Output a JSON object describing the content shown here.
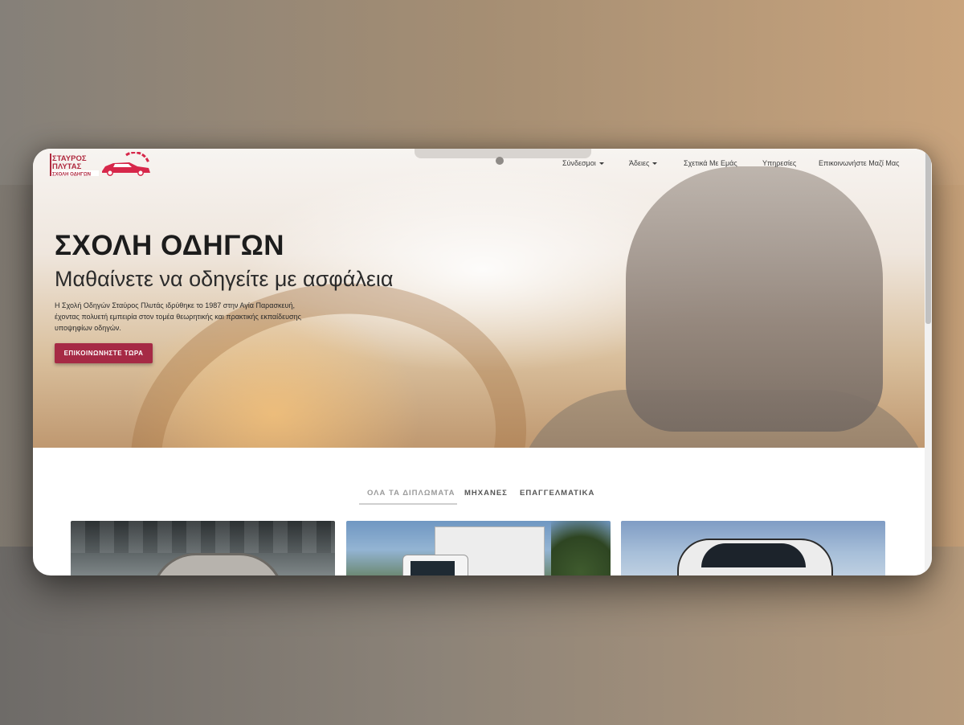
{
  "brand": {
    "logo_line1": "ΣΤΑΥΡΟΣ",
    "logo_line2": "ΠΛΥΤΑΣ",
    "logo_line3": "ΣΧΟΛΗ ΟΔΗΓΩΝ",
    "accent_color": "#a62a45"
  },
  "nav": {
    "items": [
      {
        "label": "Σύνδεσμοι",
        "dropdown": true
      },
      {
        "label": "Άδειες",
        "dropdown": true
      },
      {
        "label": "Σχετικά Με Εμάς",
        "dropdown": false
      },
      {
        "label": "Υπηρεσίες",
        "dropdown": false
      },
      {
        "label": "Επικοινωνήστε Μαζί Μας",
        "dropdown": false
      }
    ]
  },
  "hero": {
    "title": "ΣΧΟΛΗ ΟΔΗΓΩΝ",
    "subtitle": "Μαθαίνετε να οδηγείτε με ασφάλεια",
    "text_line1": "Η Σχολή Οδηγών Σταύρος Πλυτάς ιδρύθηκε το 1987 στην Αγία Παρασκευή,",
    "text_line2": "έχοντας πολυετή εμπειρία στον τομέα θεωρητικής και πρακτικής εκπαίδευσης",
    "text_line3": "υποψηφίων οδηγών.",
    "cta_label": "ΕΠΙΚΟΙΝΩΝΗΣΤΕ ΤΩΡΑ"
  },
  "tabs": [
    {
      "label": "ΟΛΑ ΤΑ ΔΙΠΛΩΜΑΤΑ",
      "active": true
    },
    {
      "label": "ΜΗΧΑΝΕΣ",
      "active": false
    },
    {
      "label": "ΕΠΑΓΓΕΛΜΑΤΙΚΑ",
      "active": false
    }
  ],
  "cards": [
    {
      "icon": "car-image"
    },
    {
      "icon": "truck-image"
    },
    {
      "icon": "bus-image"
    }
  ]
}
